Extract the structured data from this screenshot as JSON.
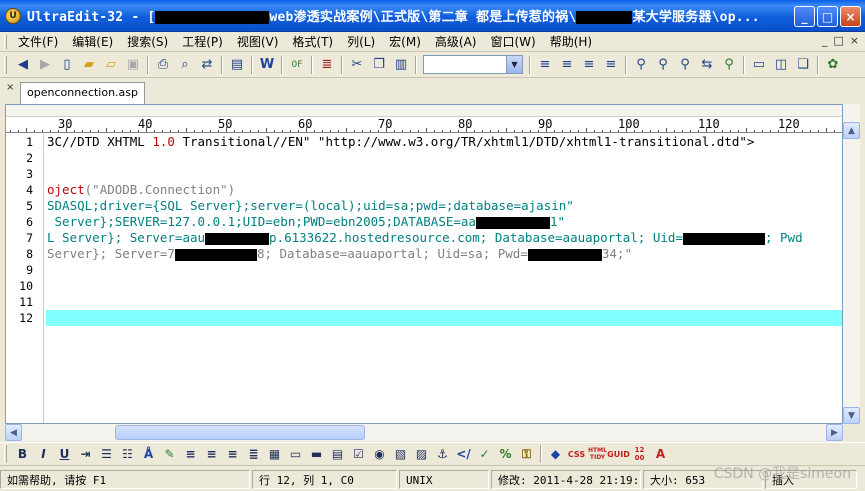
{
  "window": {
    "title_prefix": "UltraEdit-32 - [",
    "title_mid1": "web渗透实战案例\\正式版\\第二章 都是上传惹的祸\\",
    "title_mid2": "某大学服务器\\op...",
    "minimize_symbol": "_",
    "maximize_symbol": "□",
    "close_symbol": "×"
  },
  "menu": {
    "items": [
      "文件(F)",
      "编辑(E)",
      "搜索(S)",
      "工程(P)",
      "视图(V)",
      "格式(T)",
      "列(L)",
      "宏(M)",
      "高级(A)",
      "窗口(W)",
      "帮助(H)"
    ],
    "mdi_min": "_",
    "mdi_restore": "□",
    "mdi_close": "×"
  },
  "toolbar": {
    "icons": [
      "back-icon",
      "forward-icon",
      "new-file-icon",
      "open-folder-icon",
      "open-icon",
      "save-icon",
      "print-icon",
      "print-preview-icon",
      "ftp-icon",
      "spell-icon",
      "word-icon",
      "hex-icon",
      "list-icon",
      "cut-icon",
      "copy-icon",
      "paste-icon",
      "align-left-icon",
      "align-center-icon",
      "align-right-icon",
      "justify-icon",
      "find-icon",
      "find-next-icon",
      "find-prev-icon",
      "replace-icon",
      "find-files-icon",
      "window-h-icon",
      "window-v-icon",
      "cascade-icon",
      "settings-icon"
    ],
    "font_combo_value": ""
  },
  "tab": {
    "close_symbol": "×",
    "filename": "openconnection.asp"
  },
  "ruler": {
    "labels": [
      "30",
      "40",
      "50",
      "60",
      "70",
      "80",
      "90",
      "100",
      "110",
      "120"
    ]
  },
  "editor": {
    "line_numbers": [
      "1",
      "2",
      "3",
      "4",
      "5",
      "6",
      "7",
      "8",
      "9",
      "10",
      "11",
      "12"
    ],
    "current_line_index": 11,
    "line1_a": "3C//DTD XHTML ",
    "line1_b": "1.0",
    "line1_c": " Transitional//EN\" \"http://www.w3.org/TR/xhtml1/DTD/xhtml1-transitional.dtd\">",
    "line4_a": "oject",
    "line4_b": "(\"ADODB.Connection\")",
    "line5": "SDASQL;driver={SQL Server};server=(local);uid=sa;pwd=;database=ajasin\"",
    "line6_a": " Server};SERVER=127.0.0.1;UID=ebn;PWD=ebn2005;DATABASE=aa",
    "line6_b": "1\"",
    "line7_a": "L Server}; Server=aau",
    "line7_b": "p.6133622.hostedresource.com; Database=aauaportal; Uid=",
    "line7_c": "; Pwd",
    "line8_a": "Server}; Server=7",
    "line8_b": "8; Database=aauaportal; Uid=sa; Pwd=",
    "line8_c": "34;\""
  },
  "toolbar2": {
    "icons": [
      "bold-icon",
      "italic-icon",
      "underline-icon",
      "indent-icon",
      "bullets-icon",
      "numbering-icon",
      "font-color-icon",
      "highlight-icon",
      "align-left-icon",
      "align-center-icon",
      "align-right-icon",
      "justify-icon",
      "table-icon",
      "input-icon",
      "button-icon",
      "textarea-icon",
      "checkbox-icon",
      "radio-icon",
      "image-icon",
      "image-map-icon",
      "anchor-icon",
      "tag-icon",
      "spell-check-icon",
      "encoding-icon",
      "lock-icon",
      "color-picker-icon",
      "css-icon",
      "html-tidy-icon",
      "guid-icon",
      "time-icon",
      "font-icon"
    ],
    "labels": {
      "bold": "B",
      "italic": "I",
      "underline": "U",
      "css": "CSS",
      "tidy": "HTML TIDY",
      "guid": "GUID",
      "time": "12 00",
      "font": "A"
    }
  },
  "status": {
    "help": "如需帮助, 请按 F1",
    "position": "行 12, 列 1, C0",
    "line_ending": "UNIX",
    "modified": "修改: 2011-4-28 21:19:54",
    "size": "大小: 653",
    "mode": "插入"
  },
  "watermark": "CSDN @我是simeon"
}
